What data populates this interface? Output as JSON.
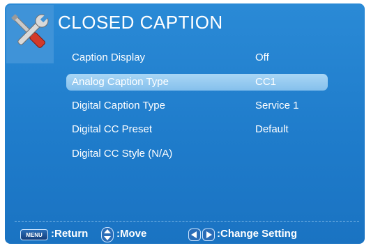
{
  "menu": {
    "title": "CLOSED CAPTION",
    "items": [
      {
        "label": "Caption Display",
        "value": "Off",
        "selected": false
      },
      {
        "label": "Analog Caption Type",
        "value": "CC1",
        "selected": true
      },
      {
        "label": "Digital Caption Type",
        "value": "Service 1",
        "selected": false
      },
      {
        "label": "Digital CC Preset",
        "value": "Default",
        "selected": false
      },
      {
        "label": "Digital CC Style (N/A)",
        "value": "",
        "selected": false
      }
    ]
  },
  "footer": {
    "menu_key": "MENU",
    "return_label": ":Return",
    "move_label": ":Move",
    "change_label": ":Change Setting"
  },
  "icons": {
    "header": "tools-icon",
    "move": "up-down-arrow-icon",
    "change": "left-right-arrow-icon"
  },
  "colors": {
    "background": "#1f7ccb",
    "highlight": "#9ccdf1",
    "text": "#ffffff"
  }
}
